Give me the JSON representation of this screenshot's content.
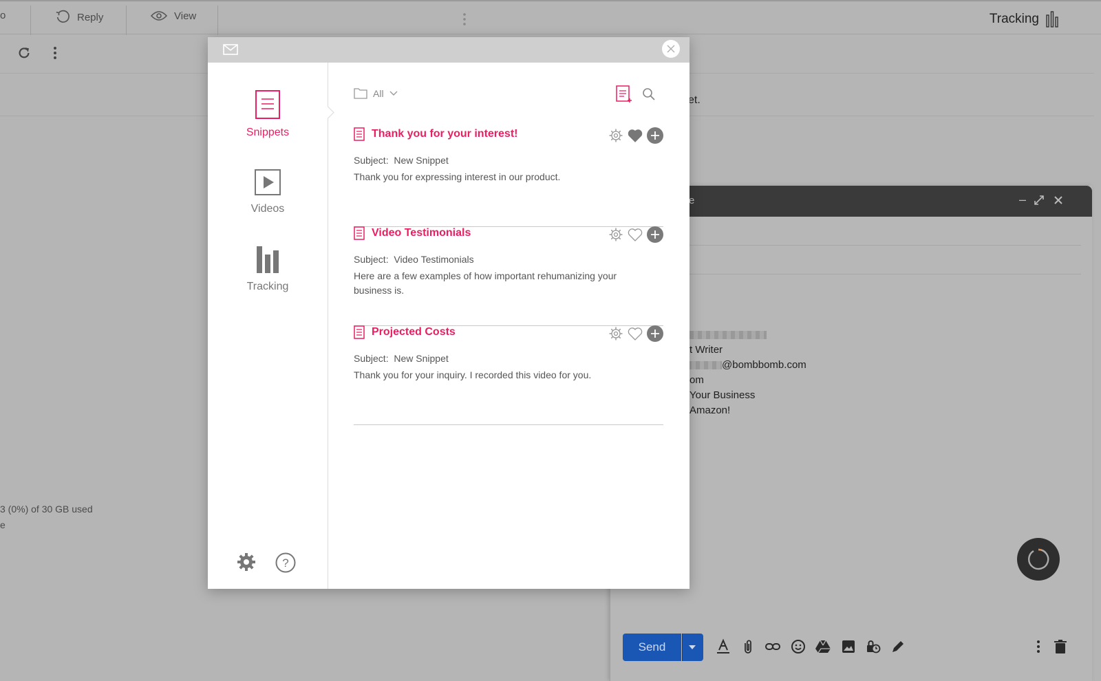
{
  "background": {
    "toolbar": {
      "partial_label": "o",
      "reply_label": "Reply",
      "view_label": "View",
      "tracking_label": "Tracking"
    },
    "body_text_fragment": "et.",
    "storage_text": "3 (0%) of 30 GB used",
    "storage_text2": "e",
    "compose": {
      "title_fragment": "e",
      "signature_lines": [
        "t Writer",
        "@bombbomb.com",
        "om",
        "Your Business",
        " Amazon!"
      ],
      "send_label": "Send"
    }
  },
  "modal": {
    "sidebar": {
      "items": [
        {
          "label": "Snippets",
          "active": true,
          "icon": "document-icon"
        },
        {
          "label": "Videos",
          "active": false,
          "icon": "play-icon"
        },
        {
          "label": "Tracking",
          "active": false,
          "icon": "bar-chart-icon"
        }
      ]
    },
    "filter": {
      "label": "All"
    },
    "snippets": [
      {
        "title": "Thank you for your interest!",
        "subject_label": "Subject:",
        "subject": "New Snippet",
        "body": "Thank you for expressing interest in our product.",
        "favorite": true
      },
      {
        "title": "Video Testimonials",
        "subject_label": "Subject:",
        "subject": "Video Testimonials",
        "body": "Here are a few examples of how important rehumanizing your business is.",
        "favorite": false
      },
      {
        "title": "Projected Costs",
        "subject_label": "Subject:",
        "subject": "New Snippet",
        "body": "Thank you for your inquiry. I recorded this video for you.",
        "favorite": false
      }
    ]
  },
  "colors": {
    "accent": "#e91e63",
    "icon_gray": "#7a7a7a",
    "send_blue": "#1a57b5"
  }
}
